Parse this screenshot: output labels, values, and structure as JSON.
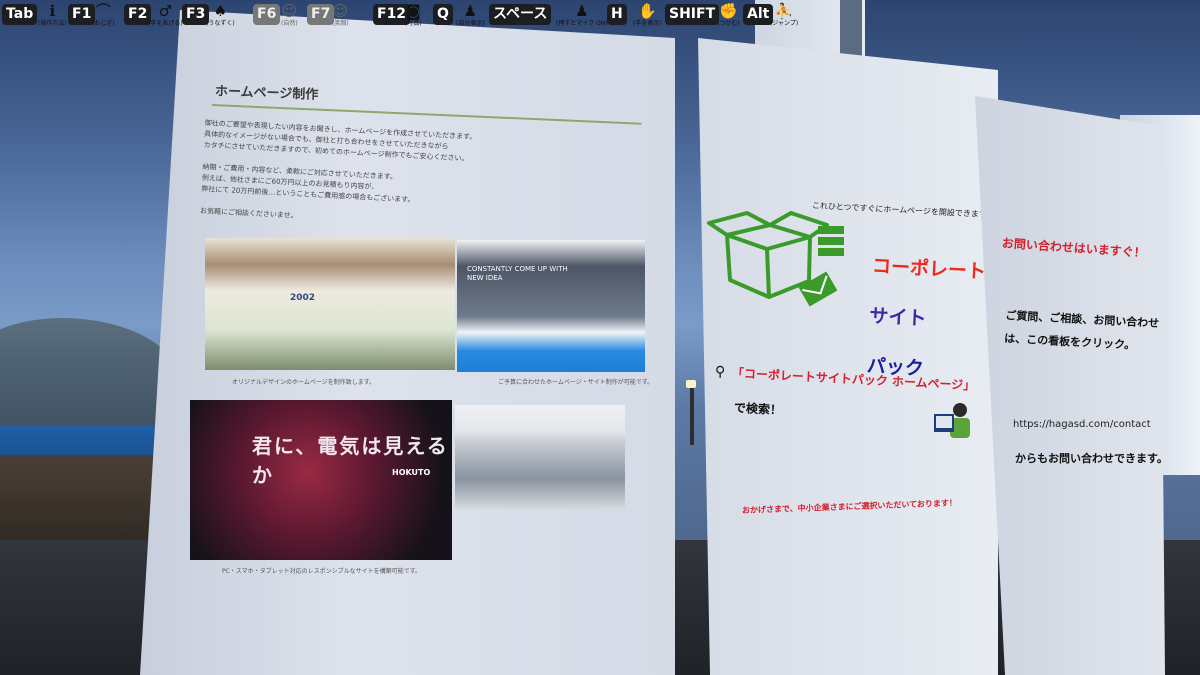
{
  "hud": [
    {
      "key": "Tab",
      "label": "(操作方法)",
      "icon": "info-icon",
      "glyph": "ℹ",
      "dim": false
    },
    {
      "key": "F1",
      "label": "(おじぎ)",
      "icon": "bow-icon",
      "glyph": "⌒",
      "dim": false
    },
    {
      "key": "F2",
      "label": "(手をあげる)",
      "icon": "raise-hand-icon",
      "glyph": "♂",
      "dim": false
    },
    {
      "key": "F3",
      "label": "(うなずく)",
      "icon": "nod-icon",
      "glyph": "♠",
      "dim": false
    },
    {
      "key": "F6",
      "label": "(自然)",
      "icon": "smile-icon",
      "glyph": "☺",
      "dim": true
    },
    {
      "key": "F7",
      "label": "(笑顔)",
      "icon": "laugh-icon",
      "glyph": "☺",
      "dim": true
    },
    {
      "key": "F12",
      "label": "(写真)",
      "icon": "camera-icon",
      "glyph": "◙",
      "dim": false
    },
    {
      "key": "Q",
      "label": "(自分表示)",
      "icon": "person-add-icon",
      "glyph": "♟",
      "dim": false
    },
    {
      "key": "スペース",
      "label": "(押すとマイク ON)",
      "icon": "microphone-icon",
      "glyph": "♟",
      "dim": false
    },
    {
      "key": "H",
      "label": "(手を表示)",
      "icon": "hand-icon",
      "glyph": "✋",
      "dim": false
    },
    {
      "key": "SHIFT",
      "label": "(つかむ)",
      "icon": "grab-icon",
      "glyph": "✊",
      "dim": false
    },
    {
      "key": "Alt",
      "label": "(ジャンプ)",
      "icon": "jump-icon",
      "glyph": "⛹",
      "dim": false
    }
  ],
  "left_panel": {
    "title": "ホームページ制作",
    "paragraph": "御社のご要望や表現したい内容をお聞きし、ホームページを作成させていただきます。\n具体的なイメージがない場合でも、御社と打ち合わせをさせていただきながら\nカタチにさせていただきますので、初めてのホームページ制作でもご安心ください。\n\n納期・ご費用・内容など、柔軟にご対応させていただきます。\n例えば、他社さまにご60万円以上のお見積もり内容が、\n弊社にて 20万円前後…ということもご費用感の場合もございます。\n\nお気軽にご相談くださいませ。",
    "shot1_year": "2002",
    "shot2_text": "CONSTANTLY COME UP WITH\nNEW IDEA",
    "shot3_text": "君に、電気は見えるか",
    "shot3_brand": "HOKUTO",
    "caption1": "オリジナルデザインのホームページを制作致します。",
    "caption2": "ご予算に合わせたホームページ・サイト制作が可能です。",
    "caption3": "PC・スマホ・タブレット対応のレスポンシブルなサイトを構築可能です。"
  },
  "mid_panel": {
    "tagline": "これひとつですぐにホームページを開設できます",
    "logo_line1": "コーポレート",
    "logo_line2": "サイト",
    "logo_line3": "パック",
    "search_phrase": "「コーポレートサイトパック ホームページ」",
    "search_suffix": "で検索！",
    "footer": "おかげさまで、中小企業さまにご選択いただいております！"
  },
  "right_panel": {
    "title": "お問い合わせはいますぐ！",
    "body": "ご質問、ご相談、お問い合わせ\nは、この看板をクリック。",
    "url": "https://hagasd.com/contact",
    "footer": "からもお問い合わせできます。"
  },
  "colors": {
    "accent_red": "#d3222e",
    "logo_red": "#ea2b1d",
    "logo_orange": "#e2791a",
    "logo_purple": "#3b2aa4",
    "logo_navy": "#1b1f9a",
    "box_green": "#3a9a2a"
  }
}
